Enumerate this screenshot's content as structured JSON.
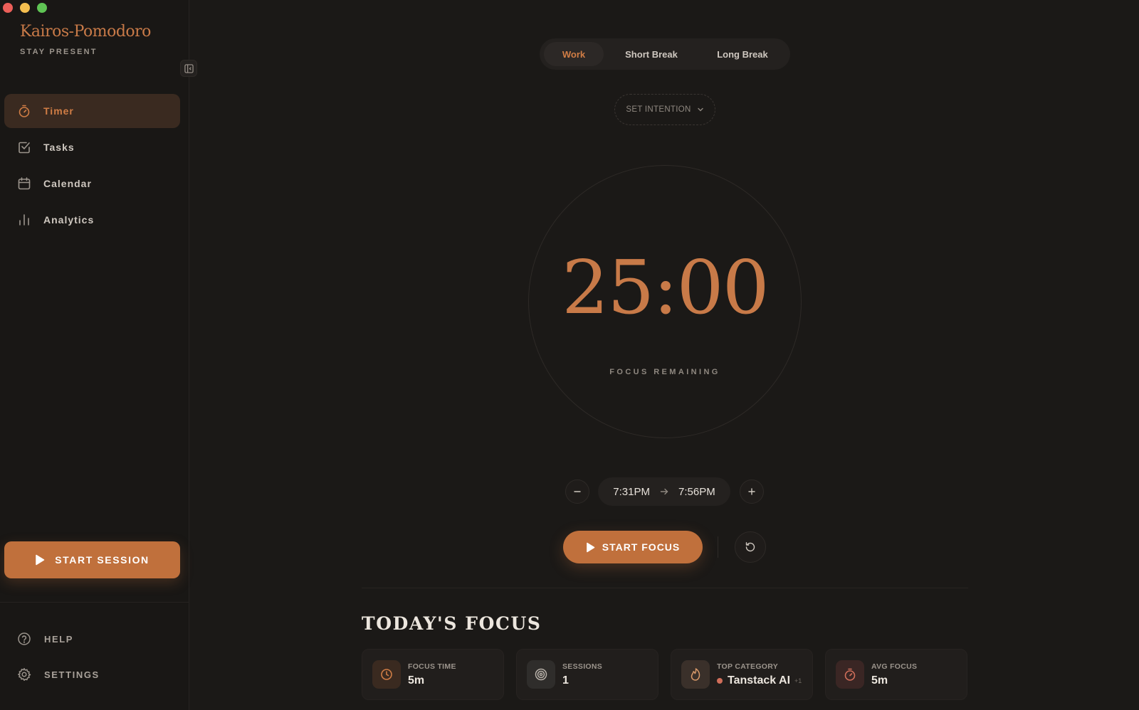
{
  "app": {
    "title": "Kairos-Pomodoro",
    "subtitle": "STAY PRESENT"
  },
  "sidebar": {
    "items": [
      {
        "label": "Timer",
        "icon": "stopwatch-icon",
        "active": true
      },
      {
        "label": "Tasks",
        "icon": "checkbox-icon",
        "active": false
      },
      {
        "label": "Calendar",
        "icon": "calendar-icon",
        "active": false
      },
      {
        "label": "Analytics",
        "icon": "bar-chart-icon",
        "active": false
      }
    ],
    "start_session_label": "START SESSION",
    "help_label": "HELP",
    "settings_label": "SETTINGS"
  },
  "modes": {
    "items": [
      "Work",
      "Short Break",
      "Long Break"
    ],
    "selected": "Work"
  },
  "intention": {
    "label": "SET INTENTION"
  },
  "timer": {
    "time": "25:00",
    "label": "FOCUS REMAINING"
  },
  "schedule": {
    "start": "7:31PM",
    "end": "7:56PM"
  },
  "controls": {
    "start_focus_label": "START FOCUS"
  },
  "today": {
    "title": "TODAY'S FOCUS",
    "stats": [
      {
        "label": "FOCUS TIME",
        "value": "5m",
        "icon": "clock-icon"
      },
      {
        "label": "SESSIONS",
        "value": "1",
        "icon": "target-icon"
      },
      {
        "label": "TOP CATEGORY",
        "value": "Tanstack AI",
        "extra": "+1",
        "icon": "flame-icon"
      },
      {
        "label": "AVG FOCUS",
        "value": "5m",
        "icon": "timer-icon"
      }
    ]
  },
  "colors": {
    "accent": "#c0703c",
    "accent_text": "#c87a48",
    "background": "#1b1917",
    "sidebar": "#191715",
    "category_dot": "#d06e5a"
  }
}
